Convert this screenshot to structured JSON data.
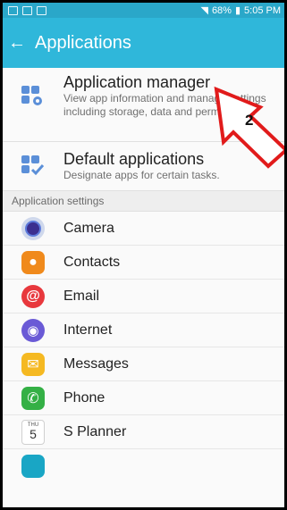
{
  "status": {
    "battery": "68%",
    "time": "5:05 PM"
  },
  "appbar": {
    "title": "Applications"
  },
  "menu": [
    {
      "title": "Application manager",
      "subtitle": "View app information and manage settings including storage, data and permissions."
    },
    {
      "title": "Default applications",
      "subtitle": "Designate apps for certain tasks."
    }
  ],
  "section_header": "Application settings",
  "apps": [
    "Camera",
    "Contacts",
    "Email",
    "Internet",
    "Messages",
    "Phone",
    "S Planner"
  ],
  "planner_icon": {
    "day": "THU",
    "date": "5"
  },
  "callout_number": "2",
  "colors": {
    "status_bar": "#2aa7c9",
    "app_bar": "#2fb7da",
    "callout_border": "#e11b1b"
  }
}
